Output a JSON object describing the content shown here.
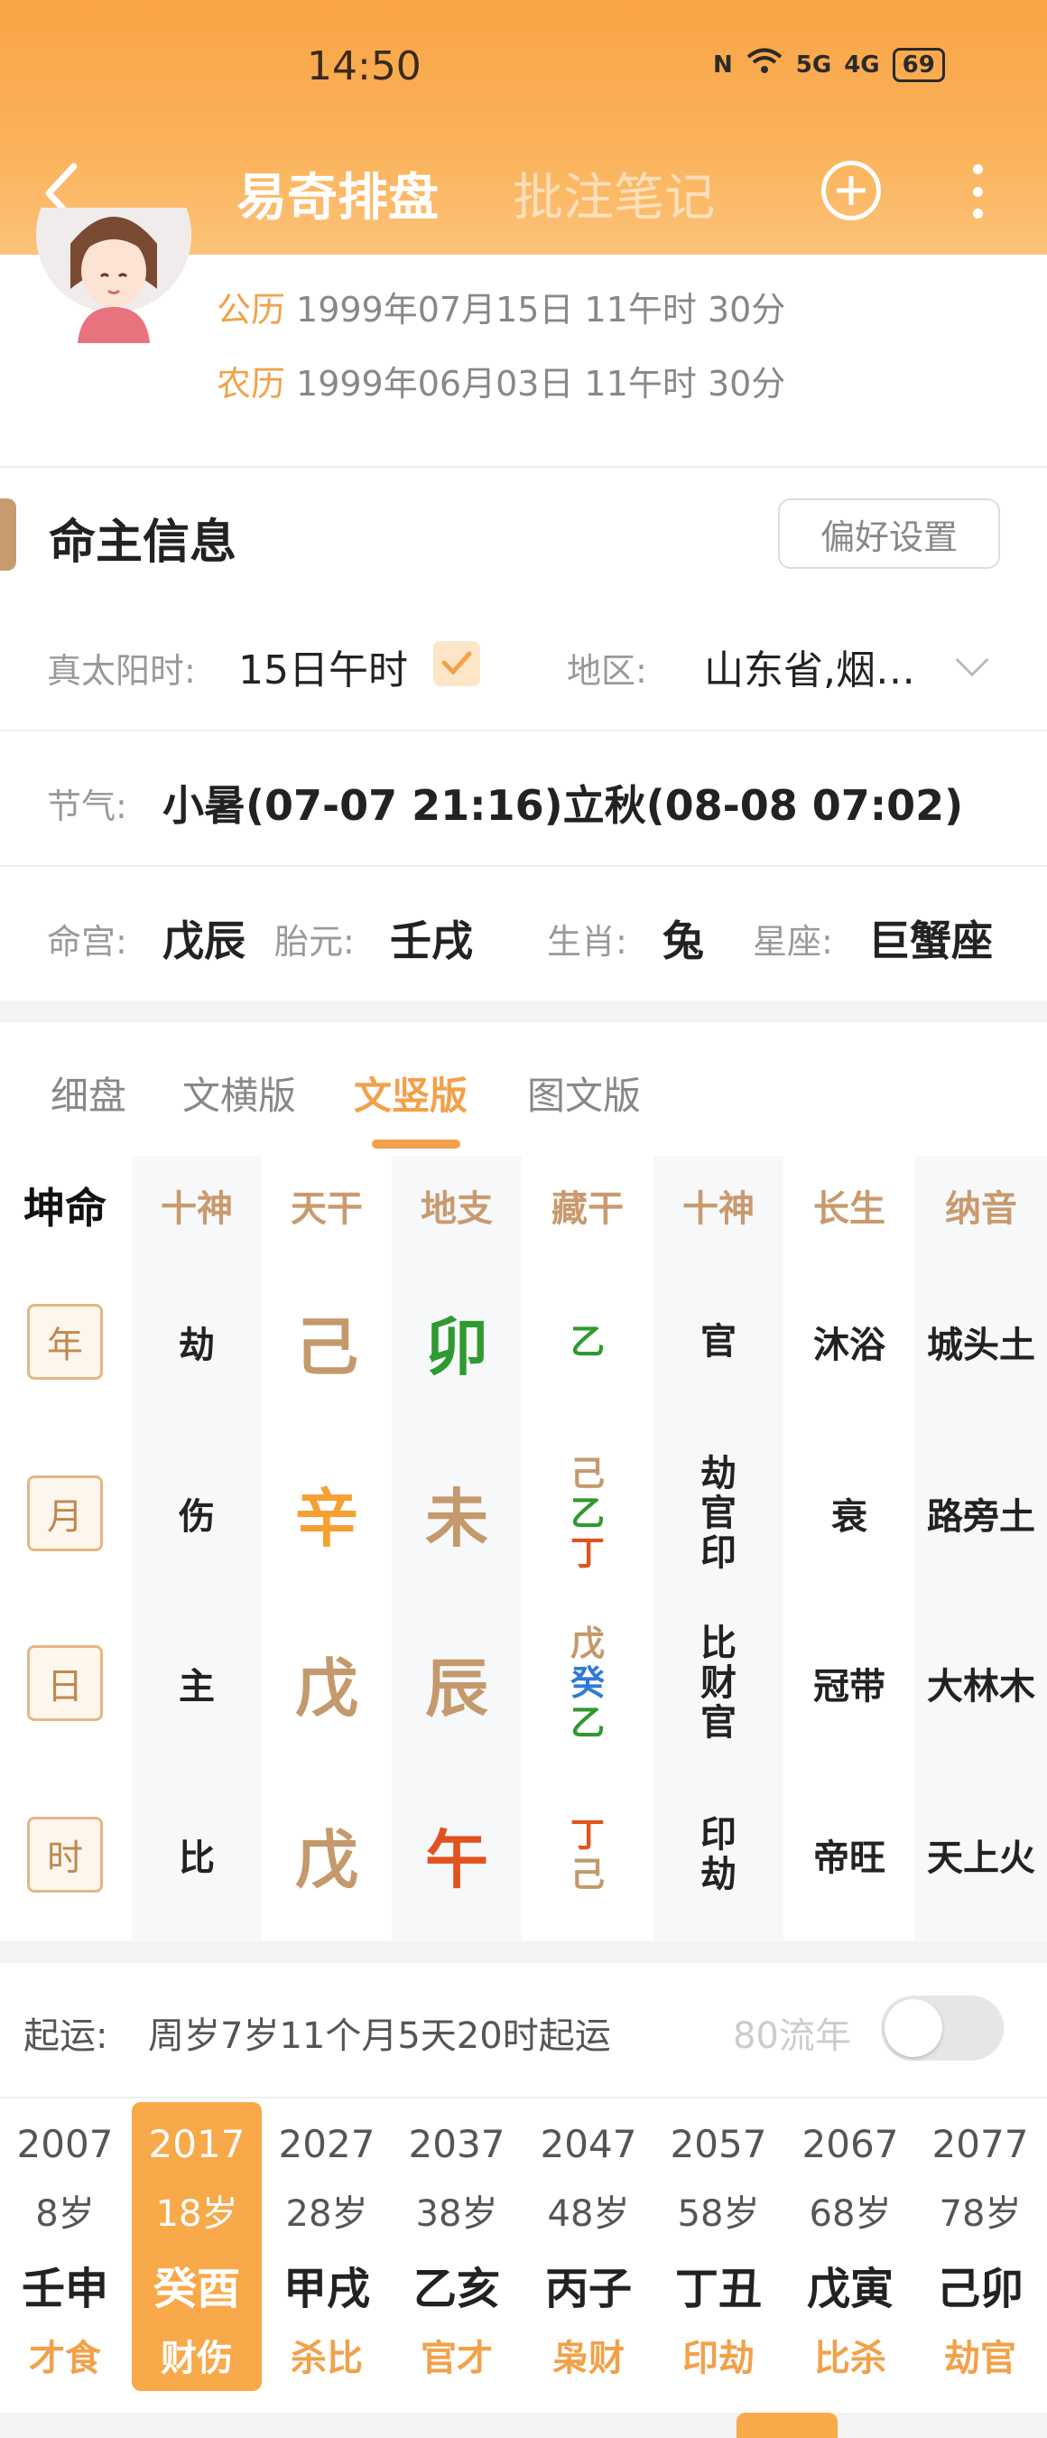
{
  "status_bar": {
    "time": "14:50",
    "signal_1": "5G",
    "signal_2": "4G",
    "battery": "69"
  },
  "nav": {
    "title": "易奇排盘",
    "title2": "批注笔记"
  },
  "profile": {
    "solar_label": "公历",
    "solar_date": "1999年07月15日 11午时 30分",
    "lunar_label": "农历",
    "lunar_date": "1999年06月03日 11午时 30分"
  },
  "info": {
    "title": "命主信息",
    "pref_button": "偏好设置",
    "true_solar_label": "真太阳时:",
    "true_solar_value": "15日午时",
    "region_label": "地区:",
    "region_value": "山东省,烟…",
    "jieqi_label": "节气:",
    "jieqi_value": "小暑(07-07 21:16)立秋(08-08 07:02)",
    "minggong_label": "命宫:",
    "minggong_value": "戊辰",
    "taiyuan_label": "胎元:",
    "taiyuan_value": "壬戌",
    "shengxiao_label": "生肖:",
    "shengxiao_value": "兔",
    "xingzuo_label": "星座:",
    "xingzuo_value": "巨蟹座"
  },
  "tabs": [
    "细盘",
    "文横版",
    "文竖版",
    "图文版"
  ],
  "active_tab": "文竖版",
  "table": {
    "corner": "坤命",
    "headers": [
      "十神",
      "天干",
      "地支",
      "藏干",
      "十神",
      "长生",
      "纳音"
    ],
    "rows": [
      {
        "label": "年",
        "shishen": "劫",
        "tiangan": "己",
        "dizhi": "卯",
        "canggan": [
          "乙"
        ],
        "shishen2": [
          "官"
        ],
        "changsheng": "沐浴",
        "nayin": "城头土"
      },
      {
        "label": "月",
        "shishen": "伤",
        "tiangan": "辛",
        "dizhi": "未",
        "canggan": [
          "己",
          "乙",
          "丁"
        ],
        "shishen2": [
          "劫",
          "官",
          "印"
        ],
        "changsheng": "衰",
        "nayin": "路旁土"
      },
      {
        "label": "日",
        "shishen": "主",
        "tiangan": "戊",
        "dizhi": "辰",
        "canggan": [
          "戊",
          "癸",
          "乙"
        ],
        "shishen2": [
          "比",
          "财",
          "官"
        ],
        "changsheng": "冠带",
        "nayin": "大林木"
      },
      {
        "label": "时",
        "shishen": "比",
        "tiangan": "戊",
        "dizhi": "午",
        "canggan": [
          "丁",
          "己"
        ],
        "shishen2": [
          "印",
          "劫"
        ],
        "changsheng": "帝旺",
        "nayin": "天上火"
      }
    ],
    "colors": {
      "earth": "#c4996c",
      "metal": "#f5a033",
      "wood": "#2f9a2f",
      "fire": "#e0531e",
      "water": "#2f7ad6"
    }
  },
  "qiyun": {
    "label": "起运:",
    "value": "周岁7岁11个月5天20时起运",
    "liunian_label": "80流年",
    "liunian_on": false
  },
  "dayun": [
    {
      "year": "2007",
      "age": "8岁",
      "ganzhi": "壬申",
      "shishen": "才食"
    },
    {
      "year": "2017",
      "age": "18岁",
      "ganzhi": "癸酉",
      "shishen": "财伤"
    },
    {
      "year": "2027",
      "age": "28岁",
      "ganzhi": "甲戌",
      "shishen": "杀比"
    },
    {
      "year": "2037",
      "age": "38岁",
      "ganzhi": "乙亥",
      "shishen": "官才"
    },
    {
      "year": "2047",
      "age": "48岁",
      "ganzhi": "丙子",
      "shishen": "枭财"
    },
    {
      "year": "2057",
      "age": "58岁",
      "ganzhi": "丁丑",
      "shishen": "印劫"
    },
    {
      "year": "2067",
      "age": "68岁",
      "ganzhi": "戊寅",
      "shishen": "比杀"
    },
    {
      "year": "2077",
      "age": "78岁",
      "ganzhi": "己卯",
      "shishen": "劫官"
    }
  ],
  "dayun_selected": "2017"
}
